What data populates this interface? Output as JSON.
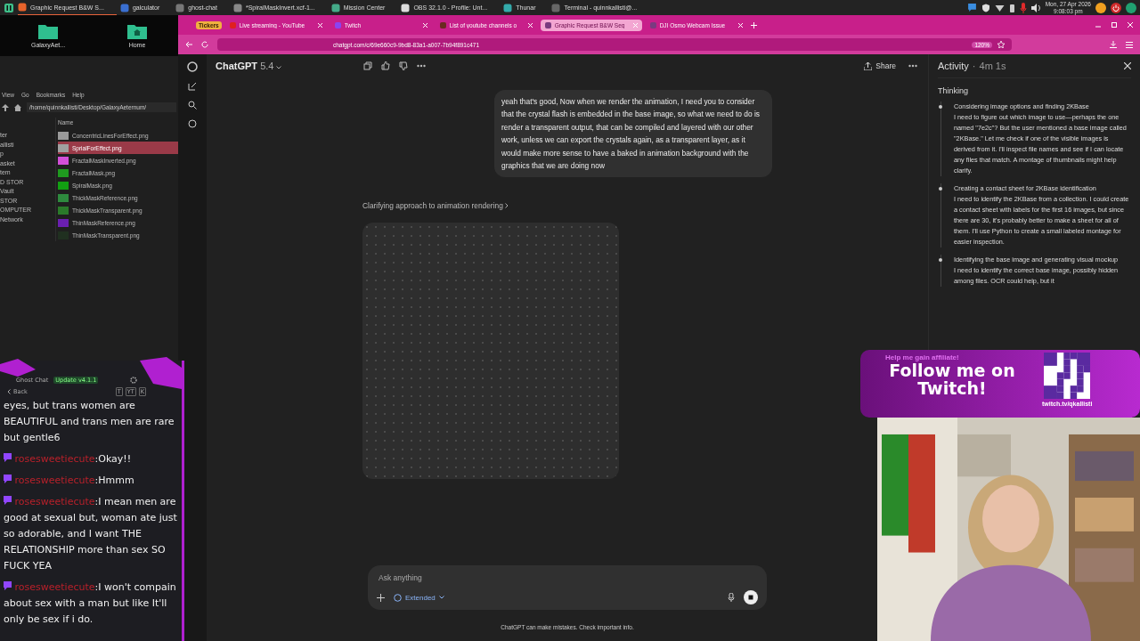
{
  "taskbar": {
    "tasks": [
      {
        "label": "Graphic Request B&W S...",
        "kind": "browser",
        "selected": true
      },
      {
        "label": "galculator",
        "kind": "calc",
        "selected": false
      },
      {
        "label": "ghost-chat",
        "kind": "ghost",
        "selected": false
      },
      {
        "label": "*SpiralMaskInvert.xcf-1...",
        "kind": "paint",
        "selected": false
      },
      {
        "label": "Mission Center",
        "kind": "monitor",
        "selected": false
      },
      {
        "label": "OBS 32.1.0 - Profile: Unt...",
        "kind": "obs",
        "selected": false
      },
      {
        "label": "Thunar",
        "kind": "folder",
        "selected": false
      },
      {
        "label": "Terminal - quinnkallisti@...",
        "kind": "terminal",
        "selected": false
      }
    ],
    "date": "Mon, 27 Apr 2026",
    "time": "9:08:03 pm"
  },
  "desktop": {
    "icons": [
      {
        "label": "GalaxyAet...",
        "kind": "folder"
      },
      {
        "label": "Home",
        "kind": "home"
      }
    ]
  },
  "file_manager": {
    "menu": [
      "View",
      "Go",
      "Bookmarks",
      "Help"
    ],
    "path": "/home/quinnkallisti/Desktop/GalaxyAeternum/",
    "sidebar": [
      "ter",
      "allisti",
      "p",
      "asket",
      "tem",
      "D STOR",
      "Vault",
      "STOR",
      "OMPUTER",
      "Network"
    ],
    "column": "Name",
    "files": [
      {
        "name": "ConcentricLinesForEffect.png",
        "color": "#9a9a9a",
        "selected": false
      },
      {
        "name": "SprialForEffect.png",
        "color": "#a0a0a0",
        "selected": true
      },
      {
        "name": "FractalMaskInverted.png",
        "color": "#d24fd8",
        "selected": false
      },
      {
        "name": "FractalMask.png",
        "color": "#1f9a1f",
        "selected": false
      },
      {
        "name": "SpiralMask.png",
        "color": "#12a012",
        "selected": false
      },
      {
        "name": "ThickMaskReference.png",
        "color": "#2e8a3e",
        "selected": false
      },
      {
        "name": "ThickMaskTransparent.png",
        "color": "#2a7a2a",
        "selected": false
      },
      {
        "name": "ThinMaskReference.png",
        "color": "#6a1fb0",
        "selected": false
      },
      {
        "name": "ThinMaskTransparent.png",
        "color": "#203020",
        "selected": false
      }
    ]
  },
  "browser": {
    "tabs": [
      {
        "label": "Tickers",
        "kind": "badge",
        "selected": false
      },
      {
        "label": "Live streaming - YouTube",
        "kind": "youtube",
        "selected": false
      },
      {
        "label": "Twitch",
        "kind": "twitch",
        "selected": false
      },
      {
        "label": "List of youtube channels o",
        "kind": "page",
        "selected": false
      },
      {
        "label": "Graphic Request B&W Seg",
        "kind": "chatgpt",
        "selected": true
      },
      {
        "label": "DJI Osmo Webcam Issue",
        "kind": "chatgpt",
        "selected": false
      }
    ],
    "url": "chatgpt.com/c/69e660c9-9bd8-83a1-a007-7b94f891c471",
    "zoom": "120%"
  },
  "chat": {
    "model": "ChatGPT",
    "version": "5.4",
    "share": "Share",
    "user_message": "yeah that's good, Now when we render the animation, I need you to consider that the crystal flash is embedded in the base image, so what we need to do is render a transparent output, that can be compiled and layered with our other work, unless we can export the crystals again, as a transparent layer, as it would make more sense to have a baked in animation background with the graphics that we are doing now",
    "status": "Clarifying approach to animation rendering",
    "composer": {
      "placeholder": "Ask anything",
      "mode": "Extended"
    },
    "disclaimer": "ChatGPT can make mistakes. Check important info."
  },
  "activity": {
    "title": "Activity",
    "separator": "·",
    "duration": "4m 1s",
    "heading": "Thinking",
    "steps": [
      {
        "title": "Considering image options and finding 2KBase",
        "text": "I need to figure out which image to use—perhaps the one named \"7e2c\"? But the user mentioned a base image called \"2KBase.\" Let me check if one of the visible images is derived from it. I'll inspect file names and see if I can locate any files that match. A montage of thumbnails might help clarify."
      },
      {
        "title": "Creating a contact sheet for 2KBase identification",
        "text": "I need to identify the 2KBase from a collection. I could create a contact sheet with labels for the first 16 images, but since there are 30, it's probably better to make a sheet for all of them. I'll use Python to create a small labeled montage for easier inspection."
      },
      {
        "title": "Identifying the base image and generating visual mockup",
        "text": "I need to identify the correct base image, possibly hidden among files. OCR could help, but it"
      }
    ]
  },
  "chat_overlay": {
    "title": "Ghost Chat",
    "badge": "Update v4.1.1",
    "back": "Back",
    "filters": [
      "T",
      "YT",
      "K"
    ],
    "messages": [
      {
        "text": "eyes, but trans women are BEAUTIFUL and trans men are rare but gentle6"
      },
      {
        "user": "rosesweetiecute",
        "separator": ":",
        "text": "Okay!!"
      },
      {
        "user": "rosesweetiecute",
        "separator": ":",
        "text": "Hmmm"
      },
      {
        "user": "rosesweetiecute",
        "separator": ":",
        "text": "I mean men are good at sexual but, woman ate just so adorable, and I want THE RELATIONSHIP more than sex SO FUCK YEA"
      },
      {
        "user": "rosesweetiecute",
        "separator": ":",
        "text": "I won't compain about sex with a man but like It'll only be sex if i do."
      }
    ]
  },
  "stream_banner": {
    "tagline": "Help me gain affiliate!",
    "headline": "Follow me on Twitch!",
    "link": "twitch.tv/qkallisti"
  }
}
